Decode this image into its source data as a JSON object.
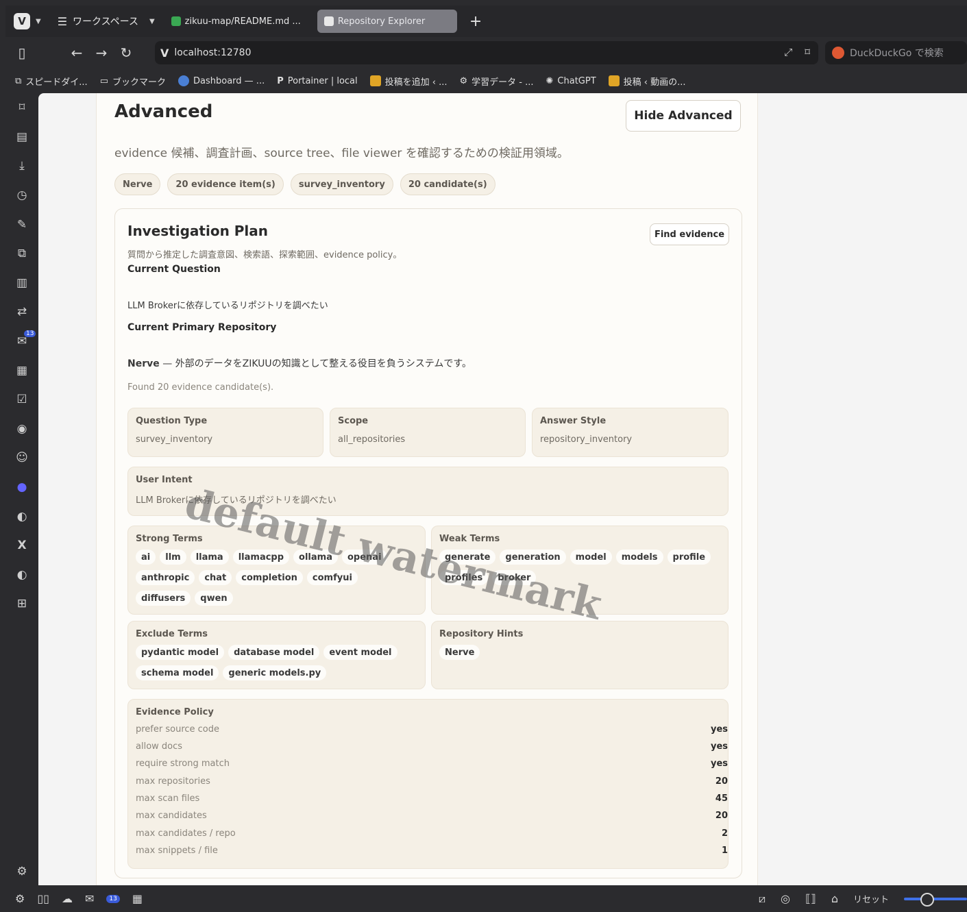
{
  "browser": {
    "workspace_label": "ワークスペース",
    "tabs": [
      {
        "label": "zikuu-map/README.md ...",
        "active": false,
        "color": "#3aa853"
      },
      {
        "label": "Repository Explorer",
        "active": true,
        "color": "#e8e8e8"
      }
    ],
    "url": "localhost:12780",
    "search_placeholder": "DuckDuckGo で検索",
    "bookmarks": [
      {
        "label": "スピードダイ...",
        "icon": "speed-dial-icon"
      },
      {
        "label": "ブックマーク",
        "icon": "folder-icon"
      },
      {
        "label": "Dashboard — ...",
        "icon": "dashboard-icon"
      },
      {
        "label": "Portainer | local",
        "icon": "portainer-icon"
      },
      {
        "label": "投稿を追加 ‹ ...",
        "icon": "wp-icon"
      },
      {
        "label": "学習データ - ...",
        "icon": "gear-icon"
      },
      {
        "label": "ChatGPT",
        "icon": "chatgpt-icon"
      },
      {
        "label": "投稿 ‹ 動画の...",
        "icon": "wp-icon"
      }
    ],
    "sidebar_badge": "13",
    "status_badge": "13",
    "zoom_reset": "リセット",
    "zoom_level": 0.3
  },
  "advanced": {
    "title": "Advanced",
    "hide_button": "Hide Advanced",
    "description": "evidence 候補、調査計画、source tree、file viewer を確認するための検証用領域。",
    "chips": [
      "Nerve",
      "20 evidence item(s)",
      "survey_inventory",
      "20 candidate(s)"
    ]
  },
  "plan": {
    "title": "Investigation Plan",
    "find_button": "Find evidence",
    "description": "質問から推定した調査意図、検索語、探索範囲、evidence policy。",
    "current_question_label": "Current Question",
    "current_question": "LLM Brokerに依存しているリポジトリを調べたい",
    "primary_repo_label": "Current Primary Repository",
    "primary_repo_name": "Nerve",
    "primary_repo_desc": " — 外部のデータをZIKUUの知識として整える役目を負うシステムです。",
    "found_text": "Found 20 evidence candidate(s).",
    "question_type_label": "Question Type",
    "question_type": "survey_inventory",
    "scope_label": "Scope",
    "scope": "all_repositories",
    "answer_style_label": "Answer Style",
    "answer_style": "repository_inventory",
    "user_intent_label": "User Intent",
    "user_intent": "LLM Brokerに依存しているリポジトリを調べたい",
    "strong_terms_label": "Strong Terms",
    "strong_terms": [
      "ai",
      "llm",
      "llama",
      "llamacpp",
      "ollama",
      "openai",
      "anthropic",
      "chat",
      "completion",
      "comfyui",
      "diffusers",
      "qwen"
    ],
    "weak_terms_label": "Weak Terms",
    "weak_terms": [
      "generate",
      "generation",
      "model",
      "models",
      "profile",
      "profiles",
      "broker"
    ],
    "exclude_terms_label": "Exclude Terms",
    "exclude_terms": [
      "pydantic model",
      "database model",
      "event model",
      "schema model",
      "generic models.py"
    ],
    "repo_hints_label": "Repository Hints",
    "repo_hints": [
      "Nerve"
    ],
    "policy_label": "Evidence Policy",
    "policy": [
      {
        "key": "prefer source code",
        "value": "yes"
      },
      {
        "key": "allow docs",
        "value": "yes"
      },
      {
        "key": "require strong match",
        "value": "yes"
      },
      {
        "key": "max repositories",
        "value": "20"
      },
      {
        "key": "max scan files",
        "value": "45"
      },
      {
        "key": "max candidates",
        "value": "20"
      },
      {
        "key": "max candidates / repo",
        "value": "2"
      },
      {
        "key": "max snippets / file",
        "value": "1"
      }
    ]
  },
  "watermark": "default watermark"
}
